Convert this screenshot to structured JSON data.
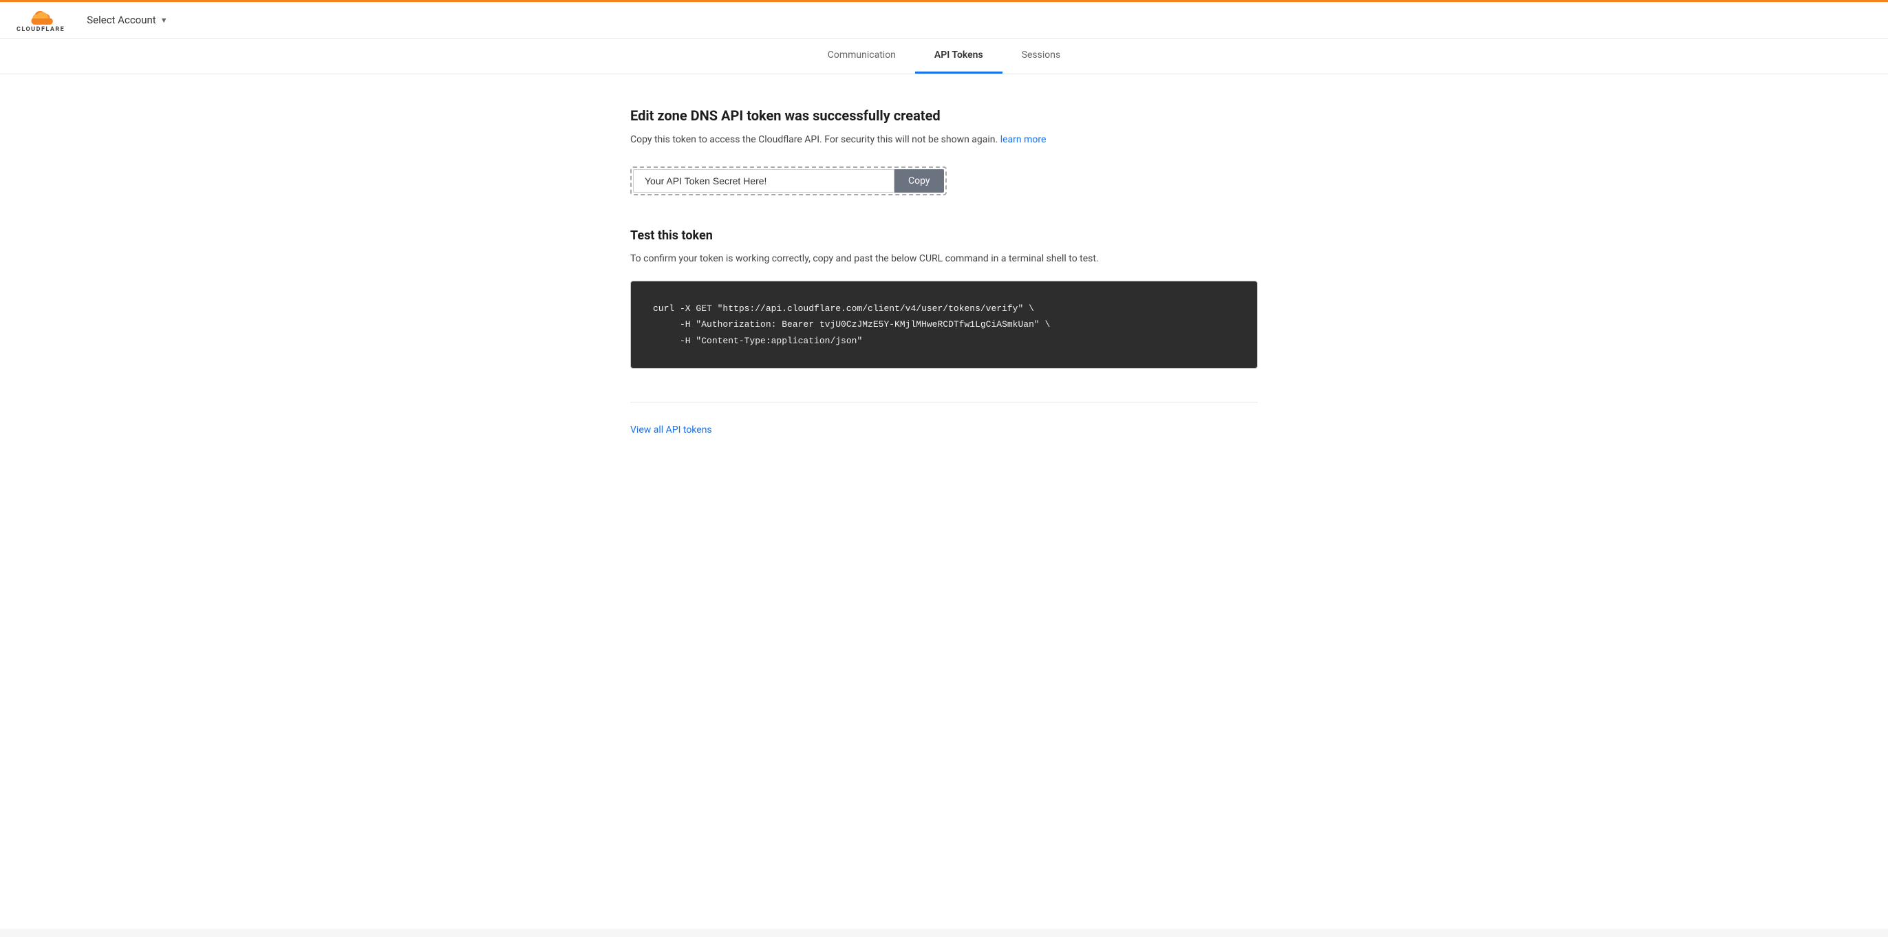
{
  "header": {
    "logo_wordmark": "CLOUDFLARE",
    "select_account_label": "Select Account",
    "chevron": "▼"
  },
  "tabs": [
    {
      "id": "communication",
      "label": "Communication",
      "active": false
    },
    {
      "id": "api-tokens",
      "label": "API Tokens",
      "active": true
    },
    {
      "id": "sessions",
      "label": "Sessions",
      "active": false
    }
  ],
  "success_section": {
    "title": "Edit zone DNS API token was successfully created",
    "description": "Copy this token to access the Cloudflare API. For security this will not be shown again.",
    "learn_more_label": "learn more",
    "learn_more_href": "#",
    "token_placeholder": "Your API Token Secret Here!",
    "copy_button_label": "Copy"
  },
  "test_section": {
    "title": "Test this token",
    "description": "To confirm your token is working correctly, copy and past the below CURL command in a terminal shell to test.",
    "curl_line1": "curl -X GET \"https://api.cloudflare.com/client/v4/user/tokens/verify\" \\",
    "curl_line2": "     -H \"Authorization: Bearer tvjU0CzJMzE5Y-KMjlMHweRCDTfw1LgCiASmkUan\" \\",
    "curl_line3": "     -H \"Content-Type:application/json\""
  },
  "footer_link": {
    "label": "View all API tokens",
    "href": "#"
  }
}
